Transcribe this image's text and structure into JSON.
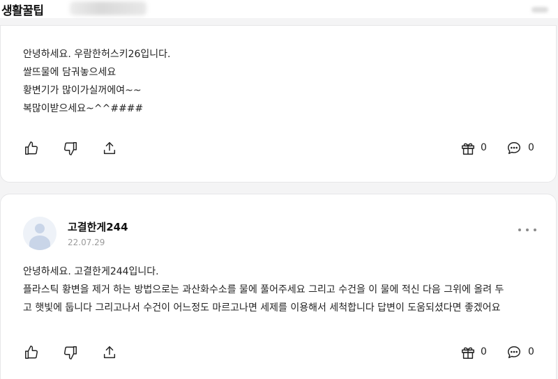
{
  "category_tag": "생활꿀팁",
  "answers": [
    {
      "lines": [
        "안녕하세요. 우람한허스키26입니다.",
        "쌀뜨물에 담궈놓으세요",
        "황변기가 많이가실꺼에여~~",
        "복많이받으세요~^^####"
      ],
      "gift_count": "0",
      "comment_count": "0"
    },
    {
      "author": "고결한게244",
      "date": "22.07.29",
      "lines": [
        "안녕하세요. 고결한게244입니다.",
        "플라스틱 황변을 제거 하는 방법으로는 과산화수소를 물에 풀어주세요 그리고 수건을 이 물에 적신 다음 그위에 올려 두",
        "고 햇빛에 둡니다 그리고나서 수건이 어느정도 마르고나면 세제를 이용해서 세척합니다 답변이 도움되셨다면 좋겠어요"
      ],
      "gift_count": "0",
      "comment_count": "0"
    }
  ],
  "icons": {
    "like": "thumbs-up-icon",
    "dislike": "thumbs-down-icon",
    "share": "share-icon",
    "gift": "gift-icon",
    "comment": "comment-icon",
    "more": "more-icon"
  }
}
